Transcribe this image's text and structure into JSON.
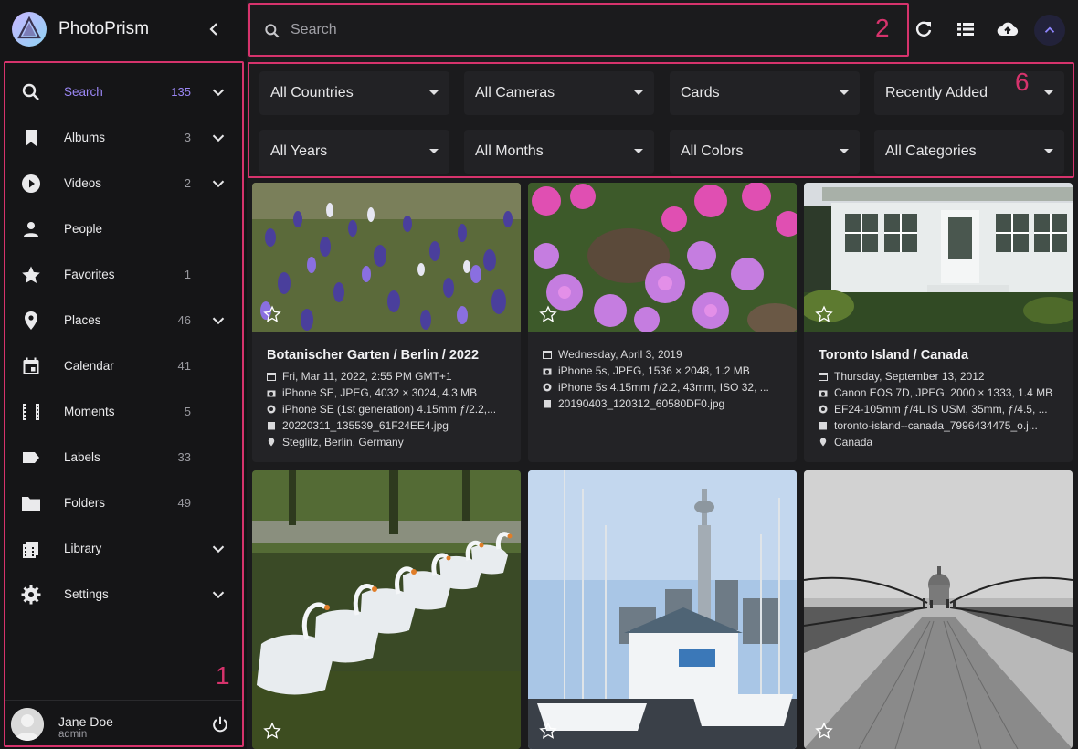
{
  "brand": {
    "name": "PhotoPrism"
  },
  "sidebar": {
    "items": [
      {
        "label": "Search",
        "count": "135",
        "chevron": true,
        "icon": "search-icon"
      },
      {
        "label": "Albums",
        "count": "3",
        "chevron": true,
        "icon": "bookmark-icon"
      },
      {
        "label": "Videos",
        "count": "2",
        "chevron": true,
        "icon": "play-circle-icon"
      },
      {
        "label": "People",
        "count": "",
        "chevron": false,
        "icon": "person-icon"
      },
      {
        "label": "Favorites",
        "count": "1",
        "chevron": false,
        "icon": "star-icon"
      },
      {
        "label": "Places",
        "count": "46",
        "chevron": true,
        "icon": "location-pin-icon"
      },
      {
        "label": "Calendar",
        "count": "41",
        "chevron": false,
        "icon": "calendar-icon"
      },
      {
        "label": "Moments",
        "count": "5",
        "chevron": false,
        "icon": "film-strip-icon"
      },
      {
        "label": "Labels",
        "count": "33",
        "chevron": false,
        "icon": "label-tag-icon"
      },
      {
        "label": "Folders",
        "count": "49",
        "chevron": false,
        "icon": "folder-icon"
      },
      {
        "label": "Library",
        "count": "",
        "chevron": true,
        "icon": "library-icon"
      },
      {
        "label": "Settings",
        "count": "",
        "chevron": true,
        "icon": "gear-icon"
      }
    ],
    "annotation": "1"
  },
  "user": {
    "name": "Jane Doe",
    "role": "admin"
  },
  "search": {
    "placeholder": "Search",
    "annotation": "2"
  },
  "filters": {
    "annotation": "6",
    "selects": [
      "All Countries",
      "All Cameras",
      "Cards",
      "Recently Added",
      "All Years",
      "All Months",
      "All Colors",
      "All Categories"
    ]
  },
  "colors": {
    "accent": "#9b87f5",
    "annotation": "#d6336c",
    "background": "#1b1b1d",
    "card": "#232326"
  },
  "photos": [
    {
      "title": "Botanischer Garten / Berlin / 2022",
      "date": "Fri, Mar 11, 2022, 2:55 PM GMT+1",
      "camera": "iPhone SE, JPEG, 4032 × 3024, 4.3 MB",
      "lens": "iPhone SE (1st generation) 4.15mm ƒ/2.2,...",
      "file": "20220311_135539_61F24EE4.jpg",
      "location": "Steglitz, Berlin, Germany"
    },
    {
      "title": "",
      "date": "Wednesday, April 3, 2019",
      "camera": "iPhone 5s, JPEG, 1536 × 2048, 1.2 MB",
      "lens": "iPhone 5s 4.15mm ƒ/2.2, 43mm, ISO 32, ...",
      "file": "20190403_120312_60580DF0.jpg",
      "location": ""
    },
    {
      "title": "Toronto Island / Canada",
      "date": "Thursday, September 13, 2012",
      "camera": "Canon EOS 7D, JPEG, 2000 × 1333, 1.4 MB",
      "lens": "EF24-105mm ƒ/4L IS USM, 35mm, ƒ/4.5, ...",
      "file": "toronto-island--canada_7996434475_o.j...",
      "location": "Canada"
    }
  ]
}
